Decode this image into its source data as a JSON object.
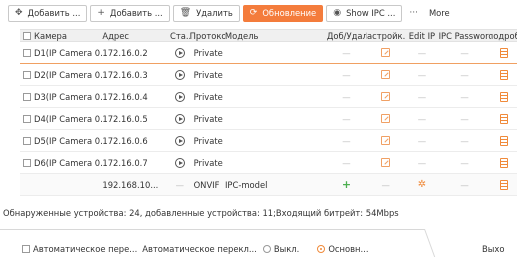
{
  "toolbar": {
    "add1": "Добавить ...",
    "add2": "Добавить ...",
    "delete": "Удалить",
    "refresh": "Обновление",
    "show_ipc": "Show IPC ...",
    "more": "More"
  },
  "icons": {
    "add1": "pin-icon",
    "add2": "plus-icon",
    "delete": "trash-icon",
    "refresh": "refresh-icon",
    "show_ipc": "eye-icon",
    "more": "ellipsis-icon"
  },
  "colors": {
    "accent": "#f47c3c",
    "add": "#4caf50"
  },
  "table": {
    "headers": [
      "Камера",
      "Адрес",
      "Ста...",
      "Протокол",
      "Модель",
      "Доб/Удал",
      "Настройк...",
      "Edit IP",
      "IPC Password",
      "подроб"
    ],
    "rows": [
      {
        "camera": "D1(IP Camera 0...",
        "address": "172.16.0.2",
        "protocol": "Private",
        "model": "",
        "add_del": "—",
        "edit_ip": "—",
        "ipc_password": "—"
      },
      {
        "camera": "D2(IP Camera 0...",
        "address": "172.16.0.3",
        "protocol": "Private",
        "model": "",
        "add_del": "—",
        "edit_ip": "—",
        "ipc_password": "—"
      },
      {
        "camera": "D3(IP Camera 0...",
        "address": "172.16.0.4",
        "protocol": "Private",
        "model": "",
        "add_del": "—",
        "edit_ip": "—",
        "ipc_password": "—"
      },
      {
        "camera": "D4(IP Camera 0...",
        "address": "172.16.0.5",
        "protocol": "Private",
        "model": "",
        "add_del": "—",
        "edit_ip": "—",
        "ipc_password": "—"
      },
      {
        "camera": "D5(IP Camera 0...",
        "address": "172.16.0.6",
        "protocol": "Private",
        "model": "",
        "add_del": "—",
        "edit_ip": "—",
        "ipc_password": "—"
      },
      {
        "camera": "D6(IP Camera 0...",
        "address": "172.16.0.7",
        "protocol": "Private",
        "model": "",
        "add_del": "—",
        "edit_ip": "—",
        "ipc_password": "—"
      },
      {
        "camera": "",
        "address": "192.168.10...",
        "status": "—",
        "protocol": "ONVIF",
        "model": "IPC-model",
        "settings": "—",
        "ipc_password": "—"
      }
    ]
  },
  "status_text": "Обнаруженные устройства: 24, добавленные устройства: 11;Входящий битрейт: 54Mbps",
  "footer": {
    "auto_label": "Автоматическое пере...",
    "auto_switch_label": "Автоматическое перекл...",
    "off": "Выкл.",
    "main": "Основн...",
    "exit": "Выхо"
  }
}
